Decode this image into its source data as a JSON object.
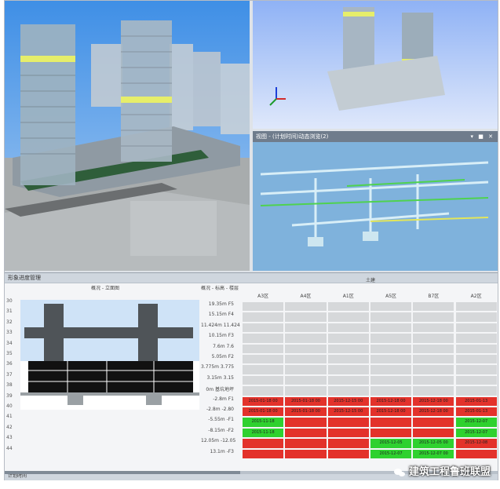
{
  "pipe_viewport": {
    "title": "视图 - (计划时间)动态浏览(2)",
    "controls": "▾ ■ ✕"
  },
  "panel": {
    "title": "形象进度管理",
    "footer": "计划时间",
    "section_label": "概况 - 立面图",
    "elev_label": "概况 - 标高 - 楼层",
    "group_label": "土建"
  },
  "row_numbers": [
    "30",
    "31",
    "32",
    "33",
    "34",
    "35",
    "36",
    "37",
    "38",
    "39",
    "40",
    "41",
    "42",
    "43",
    "44"
  ],
  "elevations": [
    "19.35m F5",
    "15.15m F4",
    "11.424m 11.424",
    "10.15m F3",
    "7.6m 7.6",
    "5.05m F2",
    "3.775m 3.775",
    "3.15m 3.15",
    "0m 基坑地坪",
    "-2.8m F1",
    "-2.8m -2.80",
    "-5.55m -F1",
    "-8.15m -F2",
    "12.05m -12.05",
    "13.1m -F3"
  ],
  "zones": [
    "A3区",
    "A4区",
    "A1区",
    "A5区",
    "B7区",
    "A2区"
  ],
  "grid_rows": [
    {
      "colors": [
        "gray",
        "gray",
        "gray",
        "gray",
        "gray",
        "gray"
      ],
      "texts": [
        "",
        "",
        "",
        "",
        "",
        ""
      ]
    },
    {
      "colors": [
        "gray",
        "gray",
        "gray",
        "gray",
        "gray",
        "gray"
      ],
      "texts": [
        "",
        "",
        "",
        "",
        "",
        ""
      ]
    },
    {
      "colors": [
        "gray",
        "gray",
        "gray",
        "gray",
        "gray",
        "gray"
      ],
      "texts": [
        "",
        "",
        "",
        "",
        "",
        ""
      ]
    },
    {
      "colors": [
        "gray",
        "gray",
        "gray",
        "gray",
        "gray",
        "gray"
      ],
      "texts": [
        "",
        "",
        "",
        "",
        "",
        ""
      ]
    },
    {
      "colors": [
        "gray",
        "gray",
        "gray",
        "gray",
        "gray",
        "gray"
      ],
      "texts": [
        "",
        "",
        "",
        "",
        "",
        ""
      ]
    },
    {
      "colors": [
        "gray",
        "gray",
        "gray",
        "gray",
        "gray",
        "gray"
      ],
      "texts": [
        "",
        "",
        "",
        "",
        "",
        ""
      ]
    },
    {
      "colors": [
        "gray",
        "gray",
        "gray",
        "gray",
        "gray",
        "gray"
      ],
      "texts": [
        "",
        "",
        "",
        "",
        "",
        ""
      ]
    },
    {
      "colors": [
        "gray",
        "gray",
        "gray",
        "gray",
        "gray",
        "gray"
      ],
      "texts": [
        "",
        "",
        "",
        "",
        "",
        ""
      ]
    },
    {
      "colors": [
        "gray",
        "gray",
        "gray",
        "gray",
        "gray",
        "gray"
      ],
      "texts": [
        "",
        "",
        "",
        "",
        "",
        ""
      ]
    },
    {
      "colors": [
        "red",
        "red",
        "red",
        "red",
        "red",
        "red"
      ],
      "texts": [
        "2015-01-18 00",
        "2015-01-18 00",
        "2015-12-15 00",
        "2015-12-18 00",
        "2015-12-18 00",
        "2015-01-13"
      ]
    },
    {
      "colors": [
        "red",
        "red",
        "red",
        "red",
        "red",
        "red"
      ],
      "texts": [
        "2015-01-18 00",
        "2015-01-18 00",
        "2015-12-15 00",
        "2015-12-18 00",
        "2015-12-18 00",
        "2015-01-13"
      ]
    },
    {
      "colors": [
        "green",
        "red",
        "red",
        "red",
        "red",
        "green"
      ],
      "texts": [
        "2015-11-18",
        "",
        "",
        "",
        "",
        "2015-12-07"
      ]
    },
    {
      "colors": [
        "green",
        "red",
        "red",
        "red",
        "red",
        "green"
      ],
      "texts": [
        "2015-11-18",
        "",
        "",
        "",
        "",
        "2015-12-07"
      ]
    },
    {
      "colors": [
        "red",
        "red",
        "red",
        "green",
        "green",
        "red"
      ],
      "texts": [
        "",
        "",
        "",
        "2015-12-05",
        "2015-12-05 00",
        "2015-12-08"
      ]
    },
    {
      "colors": [
        "red",
        "red",
        "red",
        "green",
        "green",
        "red"
      ],
      "texts": [
        "",
        "",
        "",
        "2015-12-07",
        "2015-12-07 00",
        ""
      ]
    }
  ],
  "status_colors": {
    "gray": "#d6d8da",
    "red": "#e3322b",
    "green": "#2fd12f"
  },
  "watermark": "建筑工程鲁班联盟"
}
